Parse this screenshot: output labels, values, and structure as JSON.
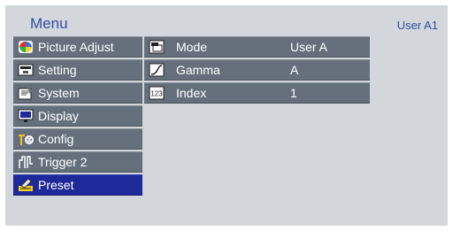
{
  "header": {
    "title": "Menu",
    "user_label": "User A1"
  },
  "menu": {
    "items": [
      {
        "label": "Picture Adjust",
        "icon": "picture-adjust-icon"
      },
      {
        "label": "Setting",
        "icon": "setting-icon"
      },
      {
        "label": "System",
        "icon": "system-icon"
      },
      {
        "label": "Display",
        "icon": "display-icon"
      },
      {
        "label": "Config",
        "icon": "config-icon"
      },
      {
        "label": "Trigger 2",
        "icon": "trigger-icon"
      },
      {
        "label": "Preset",
        "icon": "preset-icon",
        "selected": true
      }
    ]
  },
  "submenu": {
    "rows": [
      {
        "label": "Mode",
        "value": "User A",
        "icon": "mode-icon"
      },
      {
        "label": "Gamma",
        "value": "A",
        "icon": "gamma-icon"
      },
      {
        "label": "Index",
        "value": "1",
        "icon": "index-icon",
        "icon_text": "123"
      }
    ]
  },
  "colors": {
    "accent": "#2f4fa8",
    "selected": "#1f2a9a",
    "item_bg": "#65707c",
    "panel_bg": "#d3d6da"
  }
}
